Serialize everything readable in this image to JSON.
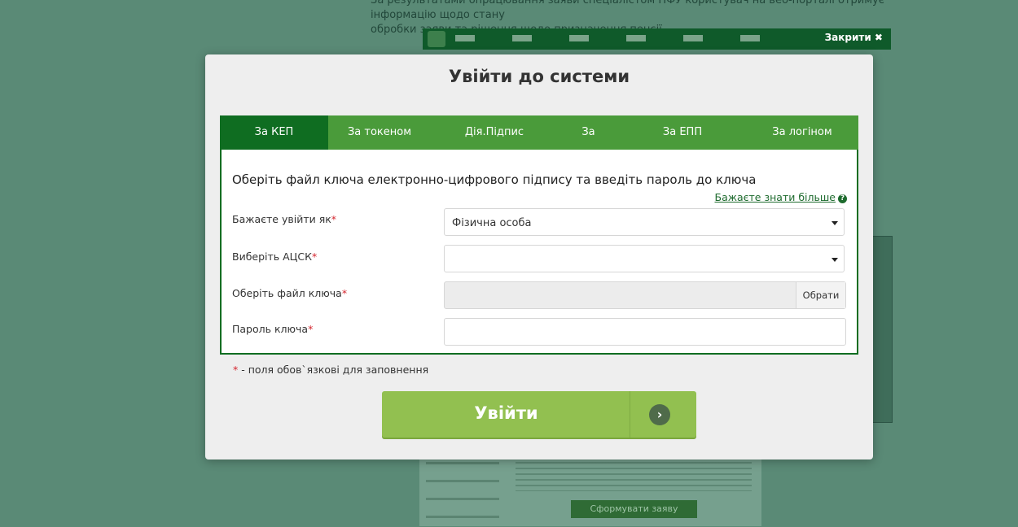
{
  "background": {
    "intro_line1": "За результатами опрацювання заяви спеціалістом ПФУ користувач на веб-порталі отримує інформацію щодо стану",
    "intro_line2": "обробки заяви та рішення щодо призначення пенсії.",
    "close_label": "Закрити ✖",
    "generate_button": "Сформувати заяву"
  },
  "modal": {
    "title": "Увійти до системи",
    "tabs": [
      {
        "label": "За КЕП",
        "active": true
      },
      {
        "label": "За токеном",
        "active": false
      },
      {
        "label": "Дія.Підпис",
        "active": false
      },
      {
        "label": "За ID.GOV.UA",
        "active": false
      },
      {
        "label": "За ЕПП",
        "active": false
      },
      {
        "label": "За логіном",
        "active": false
      }
    ],
    "heading": "Оберіть файл ключа електронно-цифрового підпису та введіть пароль до ключа",
    "learn_more": "Бажаєте знати більше",
    "help_icon": "?",
    "fields": {
      "login_as": {
        "label": "Бажаєте увійти як",
        "value": "Фізична особа"
      },
      "acsk": {
        "label": "Виберіть АЦСК",
        "value": ""
      },
      "key_file": {
        "label": "Оберіть файл ключа",
        "value": "",
        "button": "Обрати"
      },
      "password": {
        "label": "Пароль ключа",
        "value": ""
      }
    },
    "required_star": "*",
    "required_note": " - поля обов`язкові для заповнення",
    "login_button": "Увійти",
    "login_arrow": "›"
  },
  "colors": {
    "overlay": "#5a8a76",
    "tab_bar": "#4a9b3a",
    "tab_active": "#0f6d21",
    "login_button": "#92c050",
    "required": "#d4262f"
  }
}
